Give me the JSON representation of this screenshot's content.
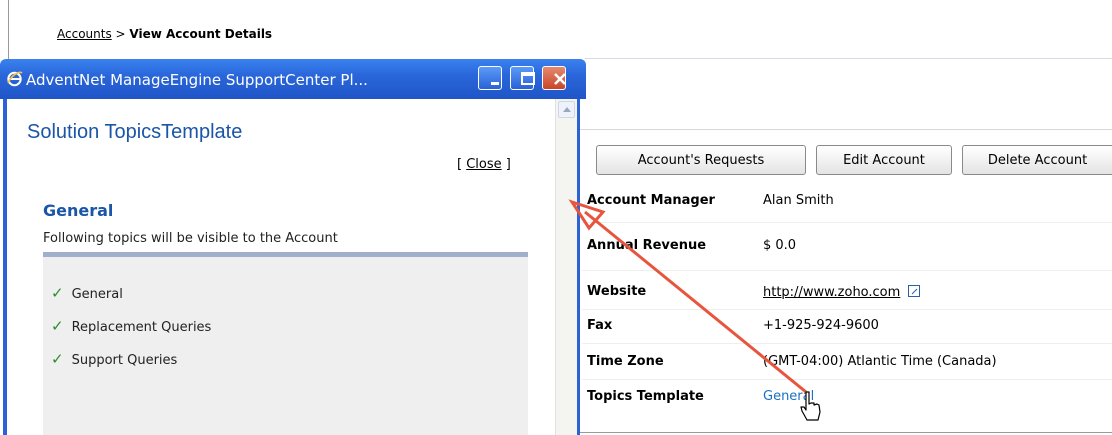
{
  "breadcrumb": {
    "parent": "Accounts",
    "separator": ">",
    "current": "View Account Details"
  },
  "popup": {
    "window_title": "AdventNet ManageEngine SupportCenter Pl...",
    "heading": "Solution TopicsTemplate",
    "close_open": "[",
    "close_label": "Close",
    "close_close": "]",
    "section_title": "General",
    "section_desc": "Following topics will be visible to the Account",
    "topics": [
      "General",
      "Replacement Queries",
      "Support Queries"
    ],
    "check_glyph": "✓"
  },
  "toolbar": {
    "requests_label": "Account's Requests",
    "edit_label": "Edit Account",
    "delete_label": "Delete Account"
  },
  "details": [
    {
      "label": "Account Manager",
      "value": "Alan Smith"
    },
    {
      "label": "Annual Revenue",
      "value": "$ 0.0"
    },
    {
      "label": "Website",
      "value": "http://www.zoho.com"
    },
    {
      "label": "Fax",
      "value": "+1-925-924-9600"
    },
    {
      "label": "Time Zone",
      "value": "(GMT-04:00) Atlantic Time (Canada)"
    },
    {
      "label": "Topics Template",
      "value": "General"
    }
  ],
  "colors": {
    "titlebar": "#2a67da",
    "heading_blue": "#1a55a8",
    "link_blue": "#1a6fc2",
    "arrow_red": "#e8553e",
    "check_green": "#2e8b2e"
  },
  "icons": [
    "ie-icon",
    "minimize-icon",
    "maximize-icon",
    "close-icon",
    "scroll-up-icon",
    "external-link-icon",
    "hand-cursor-icon",
    "check-icon"
  ]
}
